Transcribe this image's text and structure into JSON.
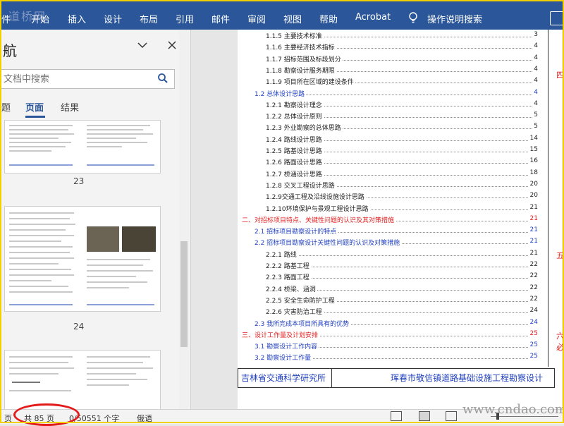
{
  "ribbon": {
    "watermark": "道桥网",
    "tabs": [
      "件",
      "开始",
      "插入",
      "设计",
      "布局",
      "引用",
      "邮件",
      "审阅",
      "视图",
      "帮助",
      "Acrobat",
      "操作说明搜索"
    ]
  },
  "nav": {
    "title": "航",
    "search_placeholder": "文档中搜索",
    "tabs": [
      "题",
      "页面",
      "结果"
    ],
    "active_tab": "页面",
    "thumbnails": [
      "23",
      "24"
    ]
  },
  "toc": [
    {
      "level": 3,
      "label": "1.1.5 主要技术标准",
      "page": "3"
    },
    {
      "level": 3,
      "label": "1.1.6 主要经济技术指标",
      "page": "4"
    },
    {
      "level": 3,
      "label": "1.1.7 招标范围及标段划分",
      "page": "4"
    },
    {
      "level": 3,
      "label": "1.1.8 勘察设计服务期限",
      "page": "4"
    },
    {
      "level": 3,
      "label": "1.1.9 项目所在区域的建设条件",
      "page": "4"
    },
    {
      "level": 2,
      "label": "1.2 总体设计思路",
      "page": "4"
    },
    {
      "level": 3,
      "label": "1.2.1 勘察设计理念",
      "page": "4"
    },
    {
      "level": 3,
      "label": "1.2.2 总体设计原则",
      "page": "5"
    },
    {
      "level": 3,
      "label": "1.2.3 外业勘察的总体思路",
      "page": "5"
    },
    {
      "level": 3,
      "label": "1.2.4 路线设计思路",
      "page": "14"
    },
    {
      "level": 3,
      "label": "1.2.5 路基设计思路",
      "page": "15"
    },
    {
      "level": 3,
      "label": "1.2.6 路面设计思路",
      "page": "16"
    },
    {
      "level": 3,
      "label": "1.2.7 桥涵设计思路",
      "page": "18"
    },
    {
      "level": 3,
      "label": "1.2.8 交叉工程设计思路",
      "page": "20"
    },
    {
      "level": 3,
      "label": "1.2.9交通工程及沿线设施设计思路",
      "page": "20"
    },
    {
      "level": 3,
      "label": "1.2.10环境保护与景观工程设计思路",
      "page": "21"
    },
    {
      "level": 1,
      "label": "二、对招标项目特点、关键性问题的认识及其对策措施",
      "page": "21"
    },
    {
      "level": 2,
      "label": "2.1 招标项目勘察设计的特点",
      "page": "21"
    },
    {
      "level": 2,
      "label": "2.2 招标项目勘察设计关键性问题的认识及对策措施",
      "page": "21"
    },
    {
      "level": 3,
      "label": "2.2.1 路线",
      "page": "21"
    },
    {
      "level": 3,
      "label": "2.2.2 路基工程",
      "page": "22"
    },
    {
      "level": 3,
      "label": "2.2.3 路面工程",
      "page": "22"
    },
    {
      "level": 3,
      "label": "2.2.4 桥梁、涵洞",
      "page": "22"
    },
    {
      "level": 3,
      "label": "2.2.5 安全生命防护工程",
      "page": "22"
    },
    {
      "level": 3,
      "label": "2.2.6 灾害防治工程",
      "page": "24"
    },
    {
      "level": 2,
      "label": "2.3 我所完成本项目所具有的优势",
      "page": "24"
    },
    {
      "level": 1,
      "label": "三、设计工作量及计划安排",
      "page": "25"
    },
    {
      "level": 2,
      "label": "3.1 勘察设计工作内容",
      "page": "25"
    },
    {
      "level": 2,
      "label": "3.2 勘察设计工作量",
      "page": "25"
    }
  ],
  "footer": {
    "left": "吉林省交通科学研究所",
    "right": "珲春市敬信镇道路基础设施工程勘察设计"
  },
  "side_marks": [
    "四",
    "五",
    "六",
    "必"
  ],
  "status": {
    "page_prefix": "页",
    "page_total": "共 85 页",
    "words": "0/50551 个字",
    "language": "俄语"
  },
  "site_watermark": "www.cndao.com"
}
